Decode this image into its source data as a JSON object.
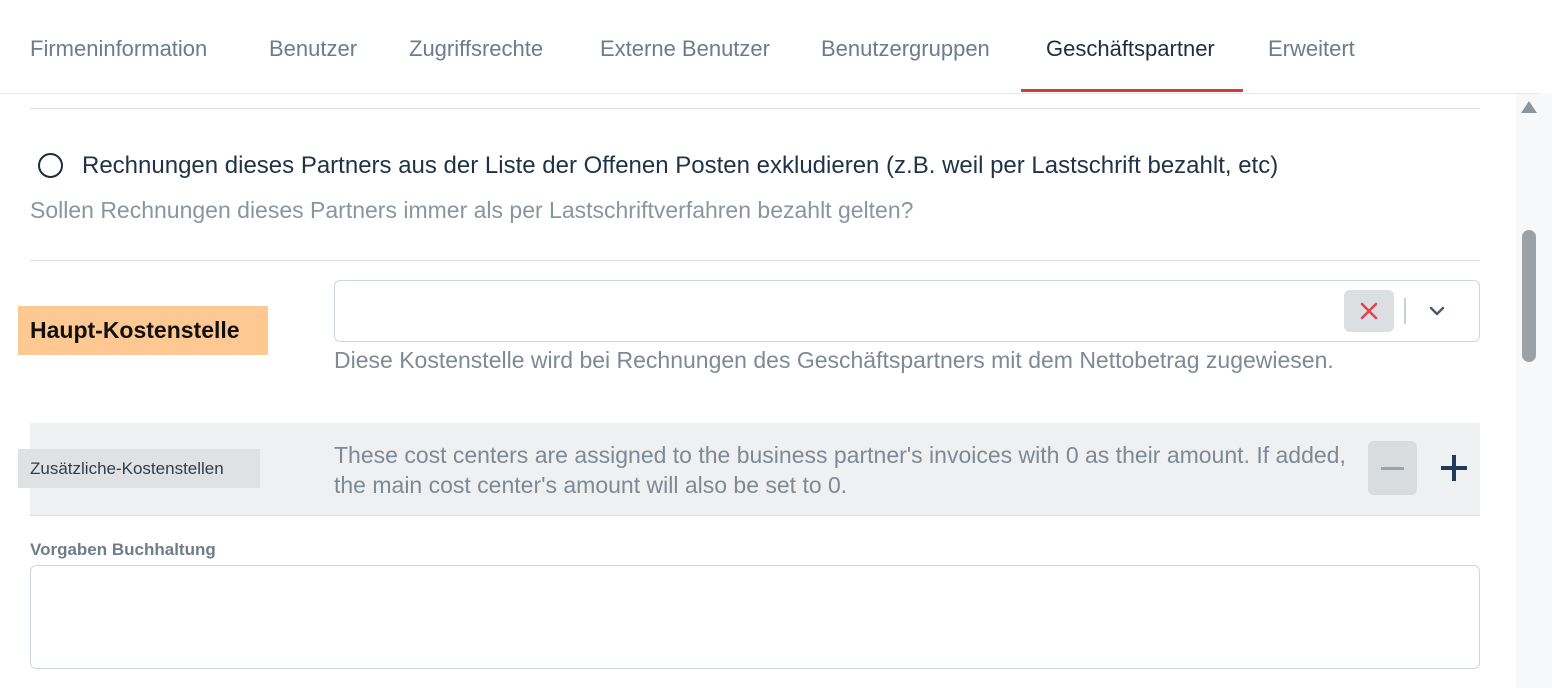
{
  "tabs": [
    {
      "label": "Firmeninformation",
      "active": false
    },
    {
      "label": "Benutzer",
      "active": false
    },
    {
      "label": "Zugriffsrechte",
      "active": false
    },
    {
      "label": "Externe Benutzer",
      "active": false
    },
    {
      "label": "Benutzergruppen",
      "active": false
    },
    {
      "label": "Geschäftspartner",
      "active": true
    },
    {
      "label": "Erweitert",
      "active": false
    }
  ],
  "exclude_option": {
    "label": "Rechnungen dieses Partners aus der Liste der Offenen Posten exkludieren (z.B. weil per Lastschrift bezahlt, etc)",
    "help": "Sollen Rechnungen dieses Partners immer als per Lastschriftverfahren bezahlt gelten?",
    "checked": false
  },
  "main_cost_center": {
    "label": "Haupt-Kostenstelle",
    "value": "",
    "help": "Diese Kostenstelle wird bei Rechnungen des Geschäftspartners mit dem Nettobetrag zugewiesen."
  },
  "additional_cost_centers": {
    "label": "Zusätzliche-Kostenstellen",
    "help": "These cost centers are assigned to the business partner's invoices with 0 as their amount. If added, the main cost center's amount will also be set to 0."
  },
  "accounting_defaults": {
    "label": "Vorgaben Buchhaltung",
    "value": ""
  },
  "colors": {
    "accent": "#d93a3a",
    "main_label_bg": "#fdc892"
  }
}
